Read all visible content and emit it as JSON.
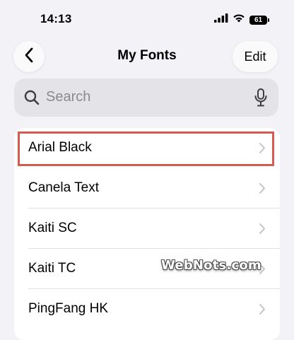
{
  "status_bar": {
    "time": "14:13",
    "battery_level": "61",
    "icons": [
      "cellular-signal-icon",
      "wifi-icon",
      "battery-icon"
    ]
  },
  "nav": {
    "back_icon": "chevron-left-icon",
    "title": "My Fonts",
    "edit_label": "Edit"
  },
  "search": {
    "placeholder": "Search",
    "leading_icon": "search-icon",
    "trailing_icon": "microphone-icon"
  },
  "fonts": [
    {
      "name": "Arial Black",
      "highlighted": true
    },
    {
      "name": "Canela Text",
      "highlighted": false
    },
    {
      "name": "Kaiti SC",
      "highlighted": false
    },
    {
      "name": "Kaiti TC",
      "highlighted": false
    },
    {
      "name": "PingFang HK",
      "highlighted": false
    }
  ],
  "watermark": "WebNots.com",
  "colors": {
    "background": "#f2f2f7",
    "highlight_border": "#d55b4e",
    "placeholder": "#8a8a8e",
    "chevron": "#c4c4c7"
  }
}
